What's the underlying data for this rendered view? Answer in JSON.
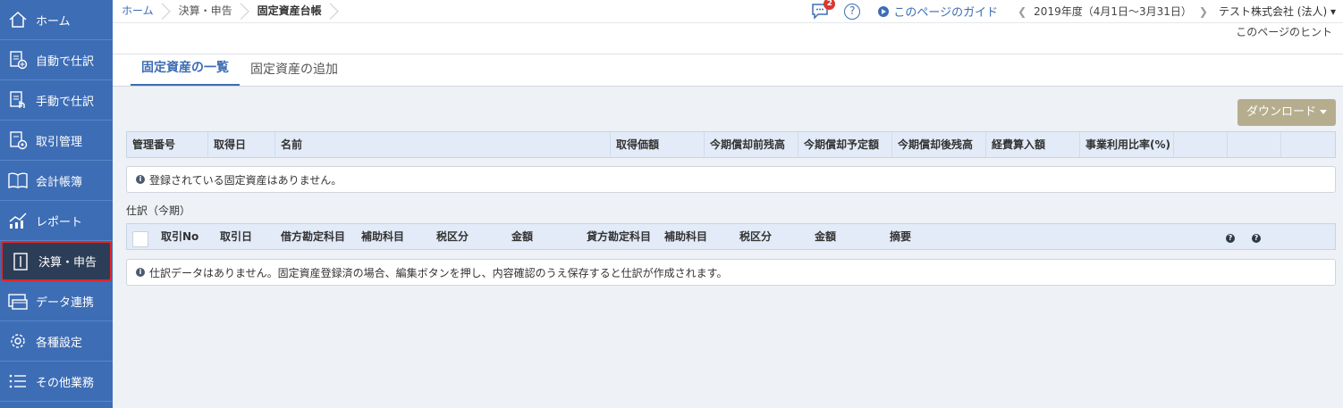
{
  "sidebar": {
    "items": [
      {
        "label": "ホーム",
        "icon": "home-icon"
      },
      {
        "label": "自動で仕訳",
        "icon": "auto-entry-icon"
      },
      {
        "label": "手動で仕訳",
        "icon": "manual-entry-icon"
      },
      {
        "label": "取引管理",
        "icon": "transaction-icon"
      },
      {
        "label": "会計帳簿",
        "icon": "ledger-icon"
      },
      {
        "label": "レポート",
        "icon": "report-icon"
      },
      {
        "label": "決算・申告",
        "icon": "closing-icon"
      },
      {
        "label": "データ連携",
        "icon": "data-link-icon"
      },
      {
        "label": "各種設定",
        "icon": "gear-icon"
      },
      {
        "label": "その他業務",
        "icon": "list-icon"
      }
    ]
  },
  "breadcrumb": {
    "home": "ホーム",
    "section": "決算・申告",
    "current": "固定資産台帳"
  },
  "header": {
    "notification_count": "2",
    "help": "?",
    "guide_label": "このページのガイド",
    "period": "2019年度（4月1日〜3月31日）",
    "company": "テスト株式会社 (法人)",
    "hint_label": "このページのヒント"
  },
  "tabs": {
    "list": "固定資産の一覧",
    "add": "固定資産の追加"
  },
  "download_label": "ダウンロード",
  "assets_table": {
    "columns": [
      "管理番号",
      "取得日",
      "名前",
      "取得価額",
      "今期償却前残高",
      "今期償却予定額",
      "今期償却後残高",
      "経費算入額",
      "事業利用比率(%)"
    ],
    "empty_message": "登録されている固定資産はありません。"
  },
  "journal": {
    "section_label": "仕訳（今期）",
    "columns": [
      "取引No",
      "取引日",
      "借方勘定科目",
      "補助科目",
      "税区分",
      "金額",
      "貸方勘定科目",
      "補助科目",
      "税区分",
      "金額",
      "摘要"
    ],
    "empty_message": "仕訳データはありません。固定資産登録済の場合、編集ボタンを押し、内容確認のうえ保存すると仕訳が作成されます。"
  },
  "colors": {
    "sidebar": "#3d6db5",
    "accent": "#3d6db5",
    "download_button": "#b5ad8d",
    "active_border": "#e0262b"
  }
}
